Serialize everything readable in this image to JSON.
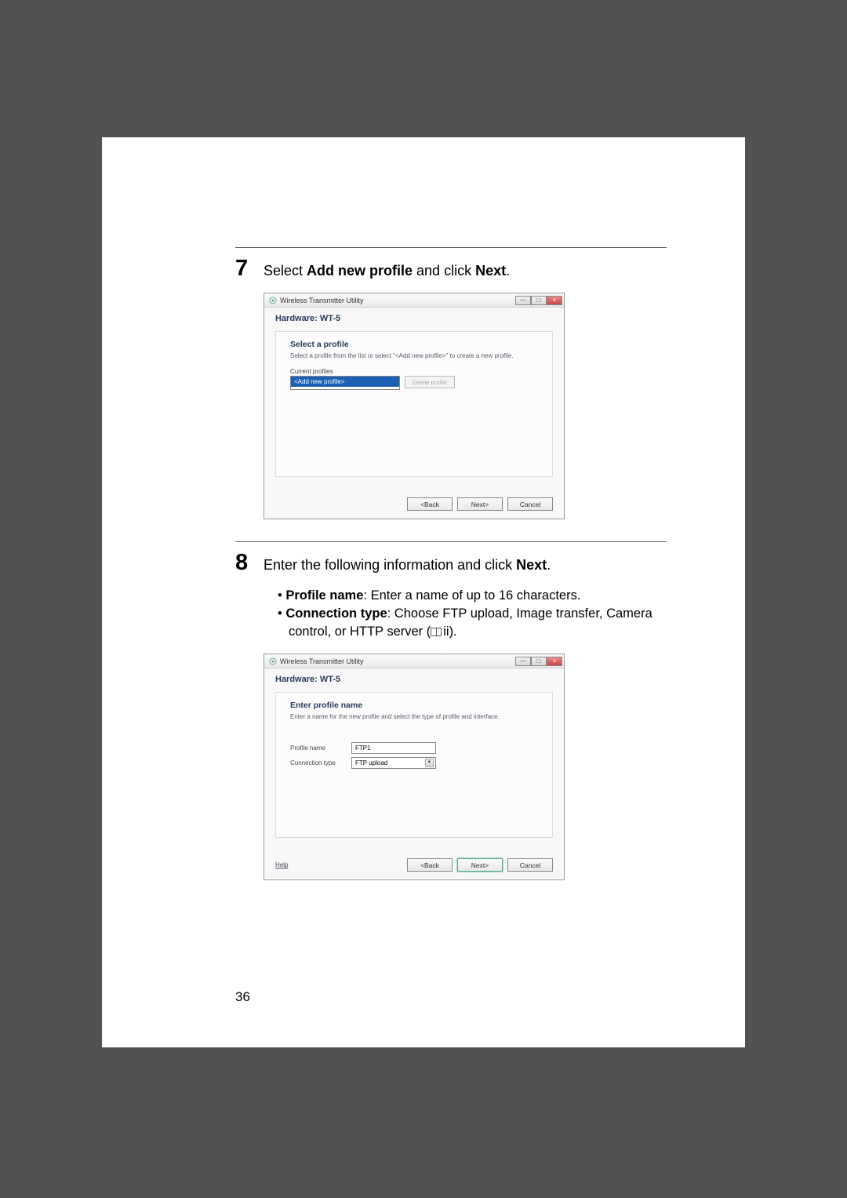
{
  "page_number": "36",
  "step7": {
    "number": "7",
    "text_prefix": "Select ",
    "text_bold1": "Add new profile",
    "text_mid": " and click ",
    "text_bold2": "Next",
    "text_suffix": "."
  },
  "step8": {
    "number": "8",
    "text_prefix": "Enter the following information and click ",
    "text_bold": "Next",
    "text_suffix": ".",
    "bullet1": {
      "label": "Profile name",
      "text": ": Enter a name of up to 16 characters."
    },
    "bullet2": {
      "label": "Connection type",
      "text": ": Choose FTP upload, Image transfer, Camera control, or HTTP server (",
      "ref": "ii).",
      "icon": "book-icon"
    }
  },
  "dialog1": {
    "title": "Wireless Transmitter Utility",
    "hardware_label": "Hardware: WT-5",
    "panel_heading": "Select a profile",
    "panel_desc": "Select a profile from the list or select \"<Add new profile>\" to create a new profile.",
    "current_label": "Current profiles",
    "listbox_selected": "<Add new profile>",
    "delete_btn": "Delete profile",
    "back_btn": "<Back",
    "next_btn": "Next>",
    "cancel_btn": "Cancel"
  },
  "dialog2": {
    "title": "Wireless Transmitter Utility",
    "hardware_label": "Hardware: WT-5",
    "panel_heading": "Enter profile name",
    "panel_desc": "Enter a name for the new profile and select the type of profile and interface.",
    "profile_name_label": "Profile name",
    "profile_name_value": "FTP1",
    "connection_type_label": "Connection type",
    "connection_type_value": "FTP upload",
    "help_link": "Help",
    "back_btn": "<Back",
    "next_btn": "Next>",
    "cancel_btn": "Cancel"
  },
  "window_controls": {
    "minimize": "—",
    "maximize": "□",
    "close": "×"
  }
}
